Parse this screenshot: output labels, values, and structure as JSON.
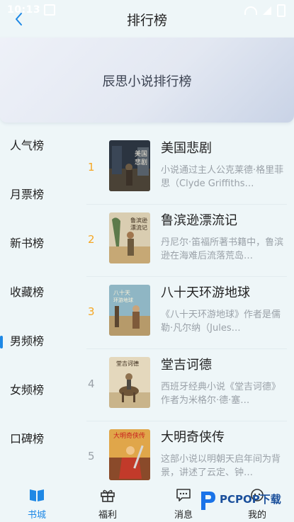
{
  "status_bar": {
    "time": "10:13"
  },
  "header": {
    "title": "排行榜"
  },
  "banner": {
    "title": "辰思小说排行榜"
  },
  "sidebar": {
    "items": [
      {
        "label": "人气榜",
        "active": false
      },
      {
        "label": "月票榜",
        "active": false
      },
      {
        "label": "新书榜",
        "active": false
      },
      {
        "label": "收藏榜",
        "active": false
      },
      {
        "label": "男频榜",
        "active": true
      },
      {
        "label": "女频榜",
        "active": false
      },
      {
        "label": "口碑榜",
        "active": false
      }
    ]
  },
  "books": [
    {
      "rank": "1",
      "title": "美国悲剧",
      "desc": "小说通过主人公克莱德·格里菲思（Clyde Griffiths…",
      "cover_text": "美国悲剧"
    },
    {
      "rank": "2",
      "title": "鲁滨逊漂流记",
      "desc": "丹尼尔·笛福所著书籍中，鲁滨逊在海难后流落荒岛…",
      "cover_text": "鲁滨逊漂流记"
    },
    {
      "rank": "3",
      "title": "八十天环游地球",
      "desc": "《八十天环游地球》作者是儒勒·凡尔纳（Jules…",
      "cover_text": "八十天环游地球"
    },
    {
      "rank": "4",
      "title": "堂吉诃德",
      "desc": "西班牙经典小说《堂吉诃德》作者为米格尔·德·塞…",
      "cover_text": "堂吉诃德"
    },
    {
      "rank": "5",
      "title": "大明奇侠传",
      "desc": "这部小说以明朝天启年间为背景，讲述了云定、钟…",
      "cover_text": "大明奇侠传"
    }
  ],
  "tabs": [
    {
      "label": "书城",
      "icon": "book-icon",
      "active": true
    },
    {
      "label": "福利",
      "icon": "gift-icon",
      "active": false
    },
    {
      "label": "消息",
      "icon": "message-icon",
      "active": false
    },
    {
      "label": "我的",
      "icon": "profile-icon",
      "active": false
    }
  ],
  "watermark": {
    "text": "PCPOP下载"
  },
  "colors": {
    "accent": "#1e88e5",
    "rank_top": "#f5a623",
    "rank_other": "#9aa1a8"
  }
}
